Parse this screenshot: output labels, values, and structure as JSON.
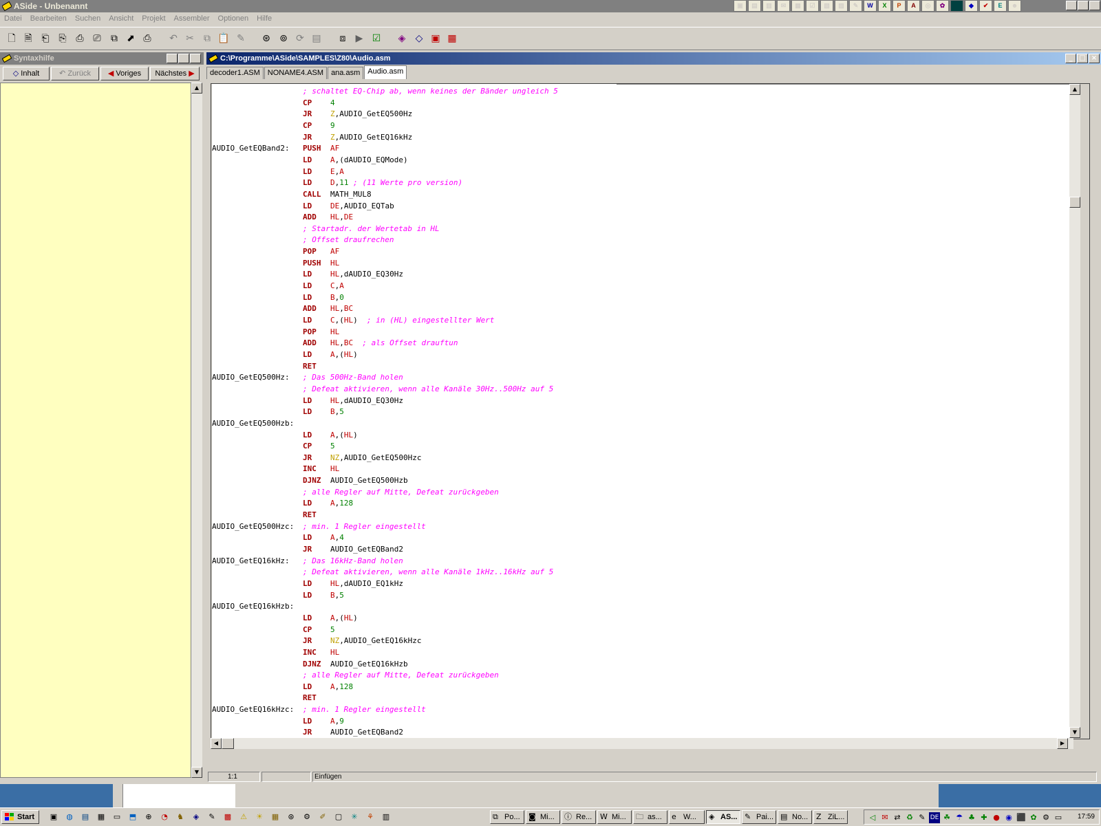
{
  "window": {
    "title": "ASide - Unbenannt"
  },
  "menu": [
    "Datei",
    "Bearbeiten",
    "Suchen",
    "Ansicht",
    "Projekt",
    "Assembler",
    "Optionen",
    "Hilfe"
  ],
  "syntax_panel": {
    "title": "Syntaxhilfe",
    "buttons": {
      "inhalt": "Inhalt",
      "zurueck": "Zurück",
      "voriges": "Voriges",
      "naechstes": "Nächstes"
    }
  },
  "editor": {
    "title": "C:\\Programme\\ASide\\SAMPLES\\Z80\\Audio.asm",
    "tabs": [
      "decoder1.ASM",
      "NONAME4.ASM",
      "ana.asm",
      "Audio.asm"
    ],
    "active_tab": "Audio.asm"
  },
  "code_lines": [
    {
      "c": "; schaltet EQ-Chip ab, wenn keines der Bänder ungleich 5"
    },
    {
      "m": "CP",
      "o": [
        [
          "4",
          "num"
        ]
      ]
    },
    {
      "m": "JR",
      "o": [
        [
          "Z",
          "fl"
        ],
        [
          ",AUDIO_GetEQ500Hz",
          ""
        ]
      ]
    },
    {
      "m": "CP",
      "o": [
        [
          "9",
          "num"
        ]
      ]
    },
    {
      "m": "JR",
      "o": [
        [
          "Z",
          "fl"
        ],
        [
          ",AUDIO_GetEQ16kHz",
          ""
        ]
      ]
    },
    {
      "l": "AUDIO_GetEQBand2:",
      "m": "PUSH",
      "o": [
        [
          "AF",
          "rg"
        ]
      ]
    },
    {
      "m": "LD",
      "o": [
        [
          "A",
          "rg"
        ],
        [
          ",(dAUDIO_EQMode)",
          ""
        ]
      ]
    },
    {
      "m": "LD",
      "o": [
        [
          "E",
          "rg"
        ],
        [
          ",",
          ""
        ],
        [
          "A",
          "rg"
        ]
      ]
    },
    {
      "m": "LD",
      "o": [
        [
          "D",
          "rg"
        ],
        [
          ",",
          ""
        ],
        [
          "11",
          "num"
        ],
        [
          " ",
          ""
        ]
      ],
      "tc": "; (11 Werte pro version)"
    },
    {
      "m": "CALL",
      "o": [
        [
          "MATH_MUL8",
          ""
        ]
      ]
    },
    {
      "m": "LD",
      "o": [
        [
          "DE",
          "rg"
        ],
        [
          ",AUDIO_EQTab",
          ""
        ]
      ]
    },
    {
      "m": "ADD",
      "o": [
        [
          "HL",
          "rg"
        ],
        [
          ",",
          ""
        ],
        [
          "DE",
          "rg"
        ]
      ]
    },
    {
      "c": "; Startadr. der Wertetab in HL"
    },
    {
      "c": "; Offset draufrechen"
    },
    {
      "m": "POP",
      "o": [
        [
          "AF",
          "rg"
        ]
      ]
    },
    {
      "m": "PUSH",
      "o": [
        [
          "HL",
          "rg"
        ]
      ]
    },
    {
      "m": "LD",
      "o": [
        [
          "HL",
          "rg"
        ],
        [
          ",dAUDIO_EQ30Hz",
          ""
        ]
      ]
    },
    {
      "m": "LD",
      "o": [
        [
          "C",
          "rg"
        ],
        [
          ",",
          ""
        ],
        [
          "A",
          "rg"
        ]
      ]
    },
    {
      "m": "LD",
      "o": [
        [
          "B",
          "rg"
        ],
        [
          ",",
          ""
        ],
        [
          "0",
          "num"
        ]
      ]
    },
    {
      "m": "ADD",
      "o": [
        [
          "HL",
          "rg"
        ],
        [
          ",",
          ""
        ],
        [
          "BC",
          "rg"
        ]
      ]
    },
    {
      "m": "LD",
      "o": [
        [
          "C",
          "rg"
        ],
        [
          ",(",
          ""
        ],
        [
          "HL",
          "rg"
        ],
        [
          ")  ",
          ""
        ]
      ],
      "tc": "; in (HL) eingestellter Wert"
    },
    {
      "m": "POP",
      "o": [
        [
          "HL",
          "rg"
        ]
      ]
    },
    {
      "m": "ADD",
      "o": [
        [
          "HL",
          "rg"
        ],
        [
          ",",
          ""
        ],
        [
          "BC",
          "rg"
        ],
        [
          "  ",
          ""
        ]
      ],
      "tc": "; als Offset drauftun"
    },
    {
      "m": "LD",
      "o": [
        [
          "A",
          "rg"
        ],
        [
          ",(",
          ""
        ],
        [
          "HL",
          "rg"
        ],
        [
          ")",
          ""
        ]
      ]
    },
    {
      "m": "RET",
      "o": []
    },
    {
      "l": "AUDIO_GetEQ500Hz:",
      "c2": "; Das 500Hz-Band holen"
    },
    {
      "c": "; Defeat aktivieren, wenn alle Kanäle 30Hz..500Hz auf 5"
    },
    {
      "m": "LD",
      "o": [
        [
          "HL",
          "rg"
        ],
        [
          ",dAUDIO_EQ30Hz",
          ""
        ]
      ]
    },
    {
      "m": "LD",
      "o": [
        [
          "B",
          "rg"
        ],
        [
          ",",
          ""
        ],
        [
          "5",
          "num"
        ]
      ]
    },
    {
      "l": "AUDIO_GetEQ500Hzb:"
    },
    {
      "m": "LD",
      "o": [
        [
          "A",
          "rg"
        ],
        [
          ",(",
          ""
        ],
        [
          "HL",
          "rg"
        ],
        [
          ")",
          ""
        ]
      ]
    },
    {
      "m": "CP",
      "o": [
        [
          "5",
          "num"
        ]
      ]
    },
    {
      "m": "JR",
      "o": [
        [
          "NZ",
          "fl"
        ],
        [
          ",AUDIO_GetEQ500Hzc",
          ""
        ]
      ]
    },
    {
      "m": "INC",
      "o": [
        [
          "HL",
          "rg"
        ]
      ]
    },
    {
      "m": "DJNZ",
      "o": [
        [
          "AUDIO_GetEQ500Hzb",
          ""
        ]
      ]
    },
    {
      "c": "; alle Regler auf Mitte, Defeat zurückgeben"
    },
    {
      "m": "LD",
      "o": [
        [
          "A",
          "rg"
        ],
        [
          ",",
          ""
        ],
        [
          "128",
          "num"
        ]
      ]
    },
    {
      "m": "RET",
      "o": []
    },
    {
      "l": "AUDIO_GetEQ500Hzc:",
      "c2": "; min. 1 Regler eingestellt"
    },
    {
      "m": "LD",
      "o": [
        [
          "A",
          "rg"
        ],
        [
          ",",
          ""
        ],
        [
          "4",
          "num"
        ]
      ]
    },
    {
      "m": "JR",
      "o": [
        [
          "AUDIO_GetEQBand2",
          ""
        ]
      ]
    },
    {
      "l": "AUDIO_GetEQ16kHz:",
      "c2": "; Das 16kHz-Band holen"
    },
    {
      "c": "; Defeat aktivieren, wenn alle Kanäle 1kHz..16kHz auf 5"
    },
    {
      "m": "LD",
      "o": [
        [
          "HL",
          "rg"
        ],
        [
          ",dAUDIO_EQ1kHz",
          ""
        ]
      ]
    },
    {
      "m": "LD",
      "o": [
        [
          "B",
          "rg"
        ],
        [
          ",",
          ""
        ],
        [
          "5",
          "num"
        ]
      ]
    },
    {
      "l": "AUDIO_GetEQ16kHzb:"
    },
    {
      "m": "LD",
      "o": [
        [
          "A",
          "rg"
        ],
        [
          ",(",
          ""
        ],
        [
          "HL",
          "rg"
        ],
        [
          ")",
          ""
        ]
      ]
    },
    {
      "m": "CP",
      "o": [
        [
          "5",
          "num"
        ]
      ]
    },
    {
      "m": "JR",
      "o": [
        [
          "NZ",
          "fl"
        ],
        [
          ",AUDIO_GetEQ16kHzc",
          ""
        ]
      ]
    },
    {
      "m": "INC",
      "o": [
        [
          "HL",
          "rg"
        ]
      ]
    },
    {
      "m": "DJNZ",
      "o": [
        [
          "AUDIO_GetEQ16kHzb",
          ""
        ]
      ]
    },
    {
      "c": "; alle Regler auf Mitte, Defeat zurückgeben"
    },
    {
      "m": "LD",
      "o": [
        [
          "A",
          "rg"
        ],
        [
          ",",
          ""
        ],
        [
          "128",
          "num"
        ]
      ]
    },
    {
      "m": "RET",
      "o": []
    },
    {
      "l": "AUDIO_GetEQ16kHzc:",
      "c2": "; min. 1 Regler eingestellt"
    },
    {
      "m": "LD",
      "o": [
        [
          "A",
          "rg"
        ],
        [
          ",",
          ""
        ],
        [
          "9",
          "num"
        ]
      ]
    },
    {
      "m": "JR",
      "o": [
        [
          "AUDIO_GetEQBand2",
          ""
        ]
      ]
    }
  ],
  "status": {
    "position": "1:1",
    "mode": "Einfügen"
  },
  "taskbar": {
    "start": "Start",
    "tasks": [
      "Po...",
      "Mi...",
      "Re...",
      "Mi...",
      "as...",
      "W...",
      "AS...",
      "Pai...",
      "No...",
      "ZiL..."
    ],
    "active_task": "AS...",
    "tray_language": "DE",
    "clock": "17:59"
  },
  "colors": {
    "mnemonic": "#a00000",
    "register": "#c00000",
    "number": "#008000",
    "flag": "#c0a000",
    "comment": "#ff00ff",
    "help_bg": "#ffffc0",
    "desktop": "#3a6ea5"
  }
}
